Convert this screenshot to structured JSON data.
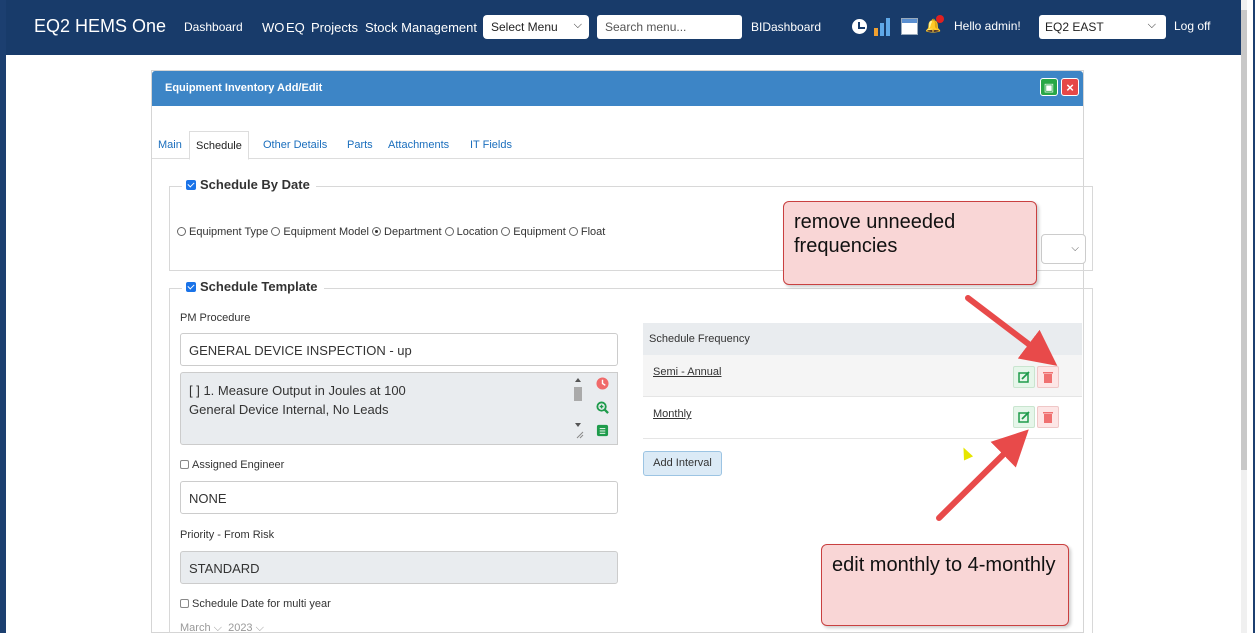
{
  "topbar": {
    "brand": "EQ2 HEMS One",
    "nav": [
      "Dashboard",
      "WO",
      "EQ",
      "Projects",
      "Stock Management"
    ],
    "select_menu": "Select Menu",
    "search_placeholder": "Search menu...",
    "bi_dashboard": "BIDashboard",
    "greeting": "Hello admin!",
    "site": "EQ2 EAST",
    "logoff": "Log off"
  },
  "panel": {
    "title": "Equipment Inventory Add/Edit",
    "tabs": [
      "Main",
      "Schedule",
      "Other Details",
      "Parts",
      "Attachments",
      "IT Fields"
    ],
    "active_tab": "Schedule"
  },
  "schedule_by_date": {
    "legend": "Schedule By Date",
    "checked": true,
    "options": [
      "Equipment Type",
      "Equipment Model",
      "Department",
      "Location",
      "Equipment",
      "Float"
    ],
    "selected": "Department"
  },
  "schedule_template": {
    "legend": "Schedule Template",
    "checked": true,
    "pm_procedure_label": "PM Procedure",
    "pm_procedure_value": "GENERAL DEVICE INSPECTION - up",
    "steps_line1": "[ ] 1. Measure Output in Joules at 100",
    "steps_line2": "General Device Internal, No Leads",
    "assigned_engineer_label": "Assigned Engineer",
    "assigned_engineer_value": "NONE",
    "priority_label": "Priority - From Risk",
    "priority_value": "STANDARD",
    "multi_year_label": "Schedule Date for multi year",
    "month": "March",
    "year": "2023"
  },
  "frequency": {
    "header": "Schedule Frequency",
    "rows": [
      "Semi - Annual",
      "Monthly"
    ],
    "add_interval": "Add Interval"
  },
  "annotations": {
    "callout1": "remove unneeded frequencies",
    "callout2": "edit monthly to 4-monthly",
    "arrow_color": "#e84a4a"
  }
}
